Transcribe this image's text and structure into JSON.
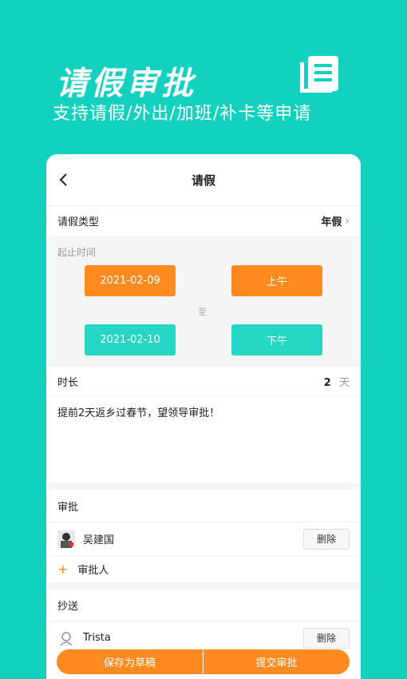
{
  "hero": {
    "title": "请假审批",
    "subtitle": "支持请假/外出/加班/补卡等申请",
    "icon": "document-list-icon"
  },
  "nav": {
    "title": "请假",
    "back_icon": "chevron-left-icon"
  },
  "leave_type": {
    "label": "请假类型",
    "value": "年假"
  },
  "time_range": {
    "label": "起止时间",
    "start_date": "2021-02-09",
    "start_period": "上午",
    "separator": "至",
    "end_date": "2021-02-10",
    "end_period": "下午"
  },
  "duration": {
    "label": "时长",
    "value": "2",
    "unit": "天"
  },
  "reason": {
    "text": "提前2天返乡过春节，望领导审批！"
  },
  "approval": {
    "label": "审批",
    "approver_name": "吴建国",
    "delete_label": "删除",
    "add_label": "审批人"
  },
  "cc": {
    "label": "抄送",
    "person_name": "Trista",
    "delete_label": "删除"
  },
  "actions": {
    "save_draft": "保存为草稿",
    "submit": "提交审批"
  },
  "colors": {
    "background": "#12D1BE",
    "orange": "#FF8A1F",
    "teal_button": "#24D6C3"
  }
}
